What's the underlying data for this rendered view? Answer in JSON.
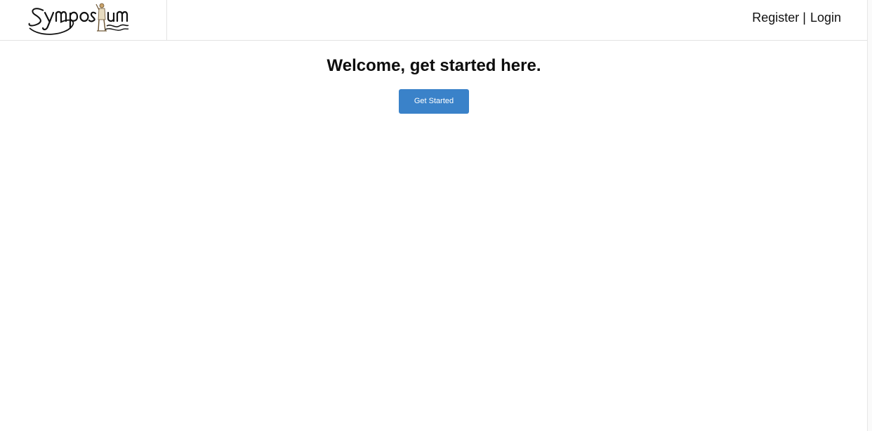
{
  "header": {
    "logo_alt": "Symposium",
    "register_label": "Register",
    "separator": "|",
    "login_label": "Login"
  },
  "main": {
    "welcome_heading": "Welcome, get started here.",
    "get_started_label": "Get Started"
  },
  "colors": {
    "button_bg": "#3a82c9",
    "border": "#e3e3e3"
  },
  "icons": {
    "logo": "symposium-logo"
  }
}
